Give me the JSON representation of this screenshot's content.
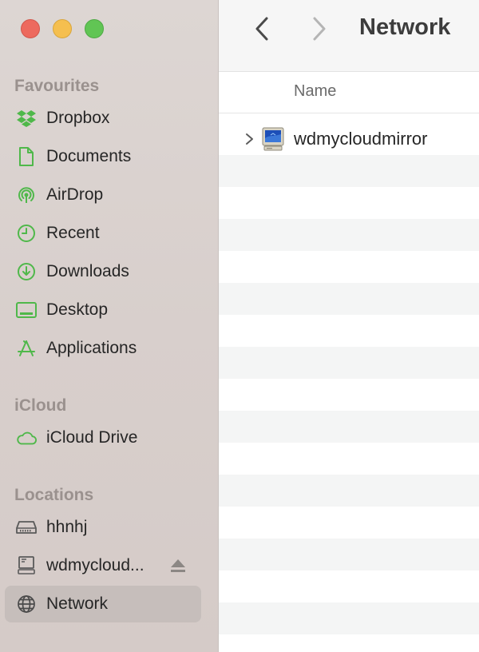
{
  "window": {
    "title": "Network"
  },
  "sidebar": {
    "sections": {
      "favourites": "Favourites",
      "icloud": "iCloud",
      "locations": "Locations"
    },
    "favourites": [
      {
        "label": "Dropbox",
        "icon": "dropbox-icon"
      },
      {
        "label": "Documents",
        "icon": "document-icon"
      },
      {
        "label": "AirDrop",
        "icon": "airdrop-icon"
      },
      {
        "label": "Recent",
        "icon": "clock-icon"
      },
      {
        "label": "Downloads",
        "icon": "download-icon"
      },
      {
        "label": "Desktop",
        "icon": "desktop-icon"
      },
      {
        "label": "Applications",
        "icon": "applications-icon"
      }
    ],
    "icloud": [
      {
        "label": "iCloud Drive",
        "icon": "cloud-icon"
      }
    ],
    "locations": [
      {
        "label": "hhnhj",
        "icon": "drive-icon"
      },
      {
        "label": "wdmycloud...",
        "icon": "computer-icon",
        "eject": true
      },
      {
        "label": "Network",
        "icon": "globe-icon",
        "selected": true
      }
    ]
  },
  "list": {
    "columns": {
      "name": "Name"
    },
    "items": [
      {
        "name": "wdmycloudmirror",
        "icon": "network-computer-icon",
        "expandable": true
      }
    ]
  },
  "colors": {
    "accent_green": "#4fb84a",
    "sidebar_bg": "#d8cfcc",
    "selection": "#c6bebb"
  }
}
